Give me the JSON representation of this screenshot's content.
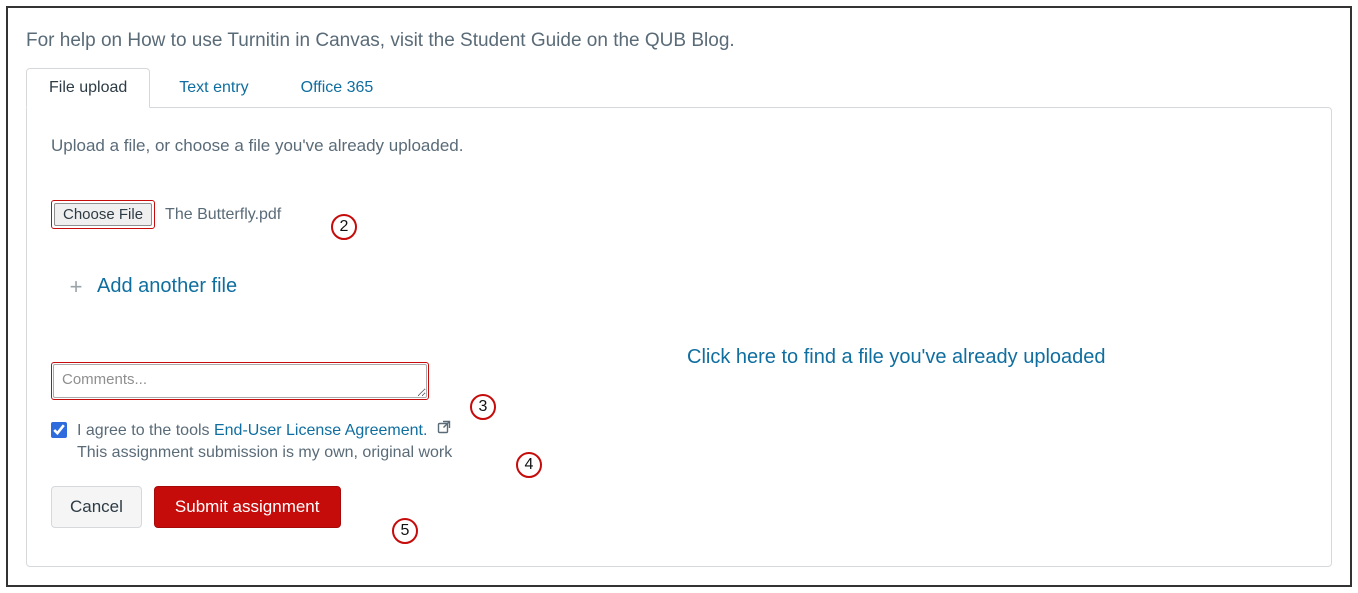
{
  "help": "For help on How to use Turnitin in Canvas, visit the Student Guide on the QUB Blog.",
  "tabs": [
    {
      "label": "File upload",
      "active": true
    },
    {
      "label": "Text entry",
      "active": false
    },
    {
      "label": "Office 365",
      "active": false
    }
  ],
  "panel": {
    "instruction": "Upload a file, or choose a file you've already uploaded.",
    "choose_label": "Choose File",
    "file_name": "The Butterfly.pdf",
    "add_another": "Add another file",
    "find_existing": "Click here to find a file you've already uploaded",
    "comments_placeholder": "Comments...",
    "agree_prefix": "I agree to the tools ",
    "eula_label": "End-User License Agreement.",
    "agree_note": "This assignment submission is my own, original work",
    "cancel_label": "Cancel",
    "submit_label": "Submit assignment"
  },
  "callouts": {
    "c2": "2",
    "c3": "3",
    "c4": "4",
    "c5": "5"
  }
}
